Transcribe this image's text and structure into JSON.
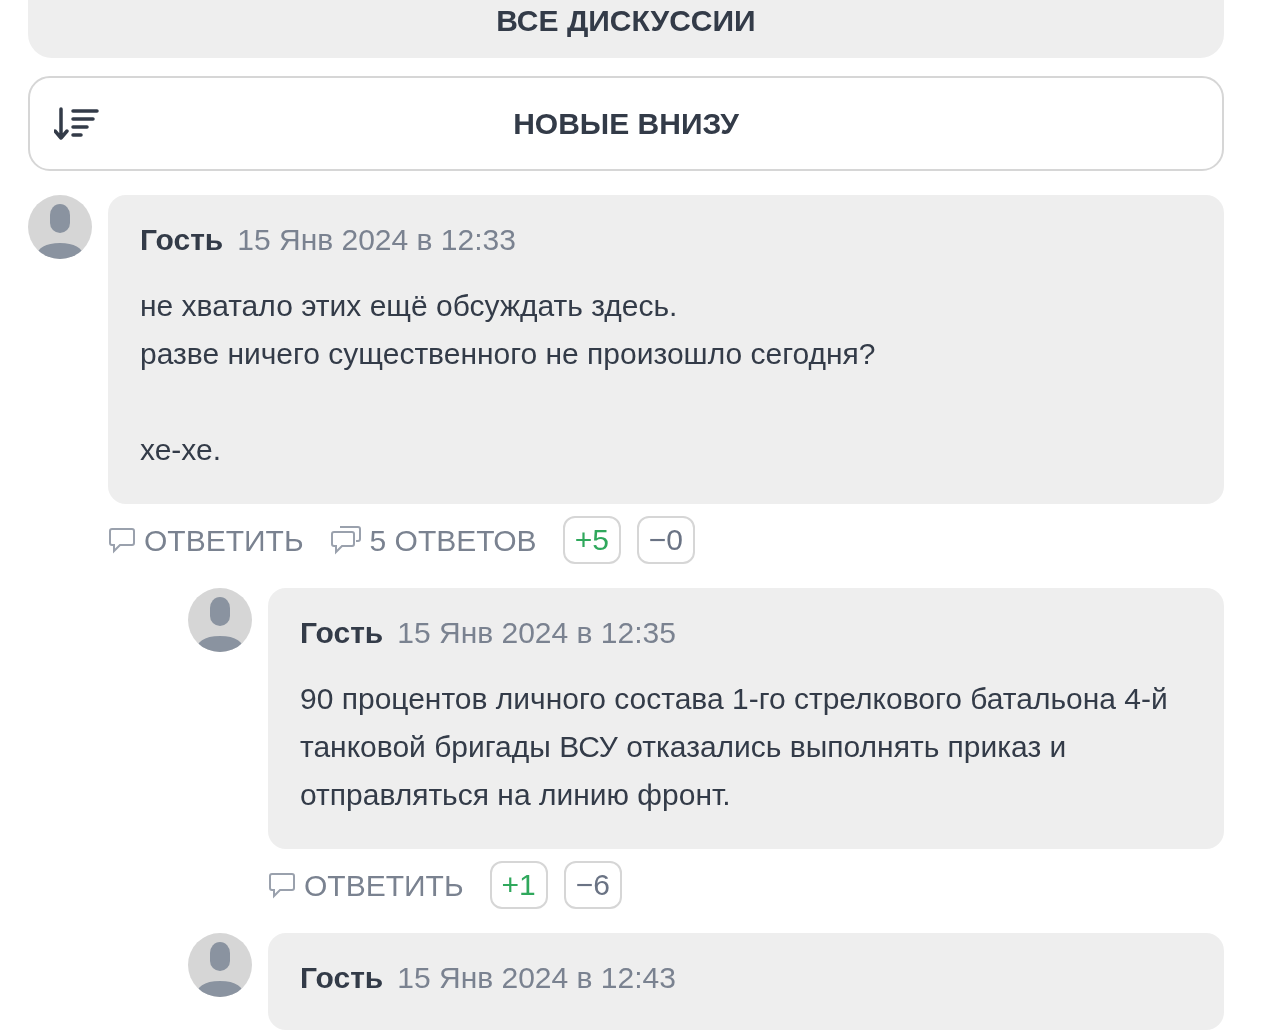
{
  "all_discussions_button": {
    "label": "ВСЕ ДИСКУССИИ"
  },
  "sort_button": {
    "label": "НОВЫЕ ВНИЗУ"
  },
  "comments": [
    {
      "author": "Гость",
      "date": "15 Янв 2024 в 12:33",
      "paragraphs": [
        "не хватало этих ещё обсуждать здесь.\nразве ничего существенного не произошло сегодня?",
        "хе-хе."
      ],
      "reply_label": "ОТВЕТИТЬ",
      "replies_count": "5 ОТВЕТОВ",
      "votes": [
        {
          "kind": "up",
          "text": "+5"
        },
        {
          "kind": "down",
          "text": "−0"
        }
      ],
      "children": [
        {
          "author": "Гость",
          "date": "15 Янв 2024 в 12:35",
          "paragraphs": [
            "90 процентов личного состава 1-го стрелкового батальона 4-й танковой бригады ВСУ отказались выполнять приказ и отправляться на линию фронт."
          ],
          "reply_label": "ОТВЕТИТЬ",
          "votes": [
            {
              "kind": "up",
              "text": "+1"
            },
            {
              "kind": "down",
              "text": "−6"
            }
          ]
        },
        {
          "author": "Гость",
          "date": "15 Янв 2024 в 12:43"
        }
      ]
    }
  ]
}
